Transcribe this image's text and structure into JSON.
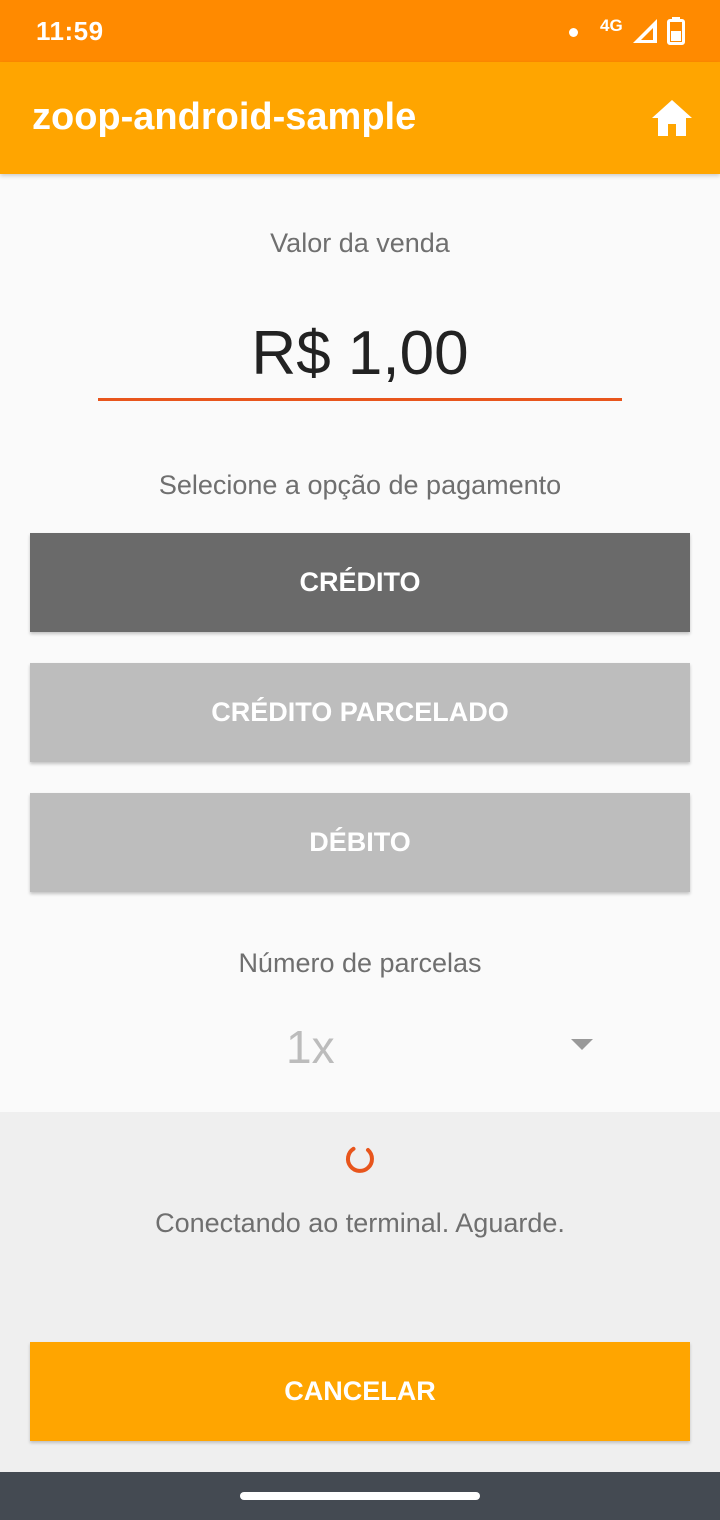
{
  "status_bar": {
    "time": "11:59",
    "network": "4G"
  },
  "app_bar": {
    "title": "zoop-android-sample",
    "home_icon": "home-icon"
  },
  "sale": {
    "label": "Valor da venda",
    "amount": "R$ 1,00"
  },
  "payment": {
    "label": "Selecione a opção de pagamento",
    "options": [
      {
        "label": "CRÉDITO",
        "selected": true
      },
      {
        "label": "CRÉDITO PARCELADO",
        "selected": false
      },
      {
        "label": "DÉBITO",
        "selected": false
      }
    ]
  },
  "installments": {
    "label": "Número de parcelas",
    "selected": "1x"
  },
  "connection": {
    "message": "Conectando ao terminal. Aguarde."
  },
  "actions": {
    "cancel_label": "CANCELAR"
  },
  "colors": {
    "status_bar": "#ff8a00",
    "app_bar": "#ffa500",
    "accent": "#e8551c",
    "selected_button": "#6a6a6a",
    "unselected_button": "#bdbdbd"
  }
}
